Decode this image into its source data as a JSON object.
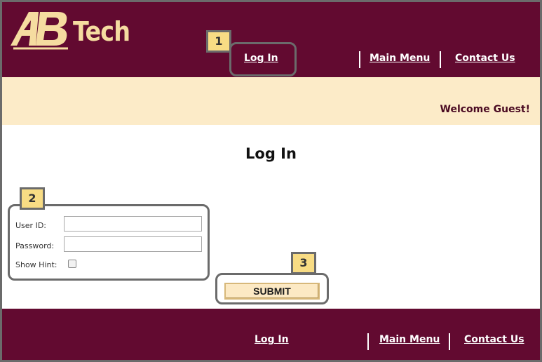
{
  "header": {
    "logo_text": "ABTech",
    "nav": {
      "login": "Log In",
      "main_menu": "Main Menu",
      "contact_us": "Contact Us"
    }
  },
  "welcome": {
    "text": "Welcome Guest!"
  },
  "main": {
    "title": "Log In",
    "form": {
      "user_id_label": "User ID:",
      "user_id_value": "",
      "password_label": "Password:",
      "password_value": "",
      "show_hint_label": "Show Hint:",
      "show_hint_checked": false
    },
    "submit_label": "SUBMIT"
  },
  "callouts": {
    "one": "1",
    "two": "2",
    "three": "3"
  },
  "footer": {
    "nav": {
      "login": "Log In",
      "main_menu": "Main Menu",
      "contact_us": "Contact Us"
    }
  },
  "colors": {
    "brand_maroon": "#620a30",
    "brand_gold": "#f5dca0",
    "welcome_bg": "#fcebc8",
    "callout_fill": "#f8dc84"
  }
}
